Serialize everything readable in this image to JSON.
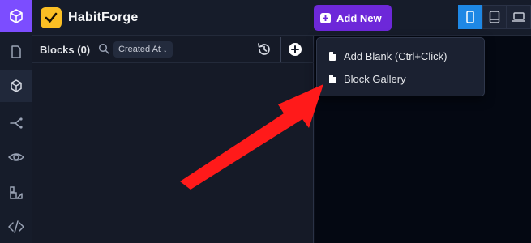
{
  "app": {
    "title": "HabitForge"
  },
  "toolbar": {
    "add_new_label": "Add New"
  },
  "rail": {
    "items": [
      {
        "name": "document-icon"
      },
      {
        "name": "cube-icon"
      },
      {
        "name": "share-icon"
      },
      {
        "name": "eye-icon"
      },
      {
        "name": "shapes-icon"
      },
      {
        "name": "code-icon"
      }
    ]
  },
  "devices": [
    {
      "name": "mobile-icon",
      "active": true
    },
    {
      "name": "tablet-icon",
      "active": false
    },
    {
      "name": "laptop-icon",
      "active": false
    }
  ],
  "blocks_panel": {
    "title": "Blocks (0)",
    "sort_label": "Created At ↓"
  },
  "dropdown": {
    "items": [
      {
        "label": "Add Blank (Ctrl+Click)"
      },
      {
        "label": "Block Gallery"
      }
    ]
  },
  "colors": {
    "accent": "#6d28d9",
    "logo": "#7c4dff",
    "brand_yellow": "#fbbf24",
    "device_active": "#1e88e5",
    "annotation_arrow": "#ff1a1a"
  }
}
